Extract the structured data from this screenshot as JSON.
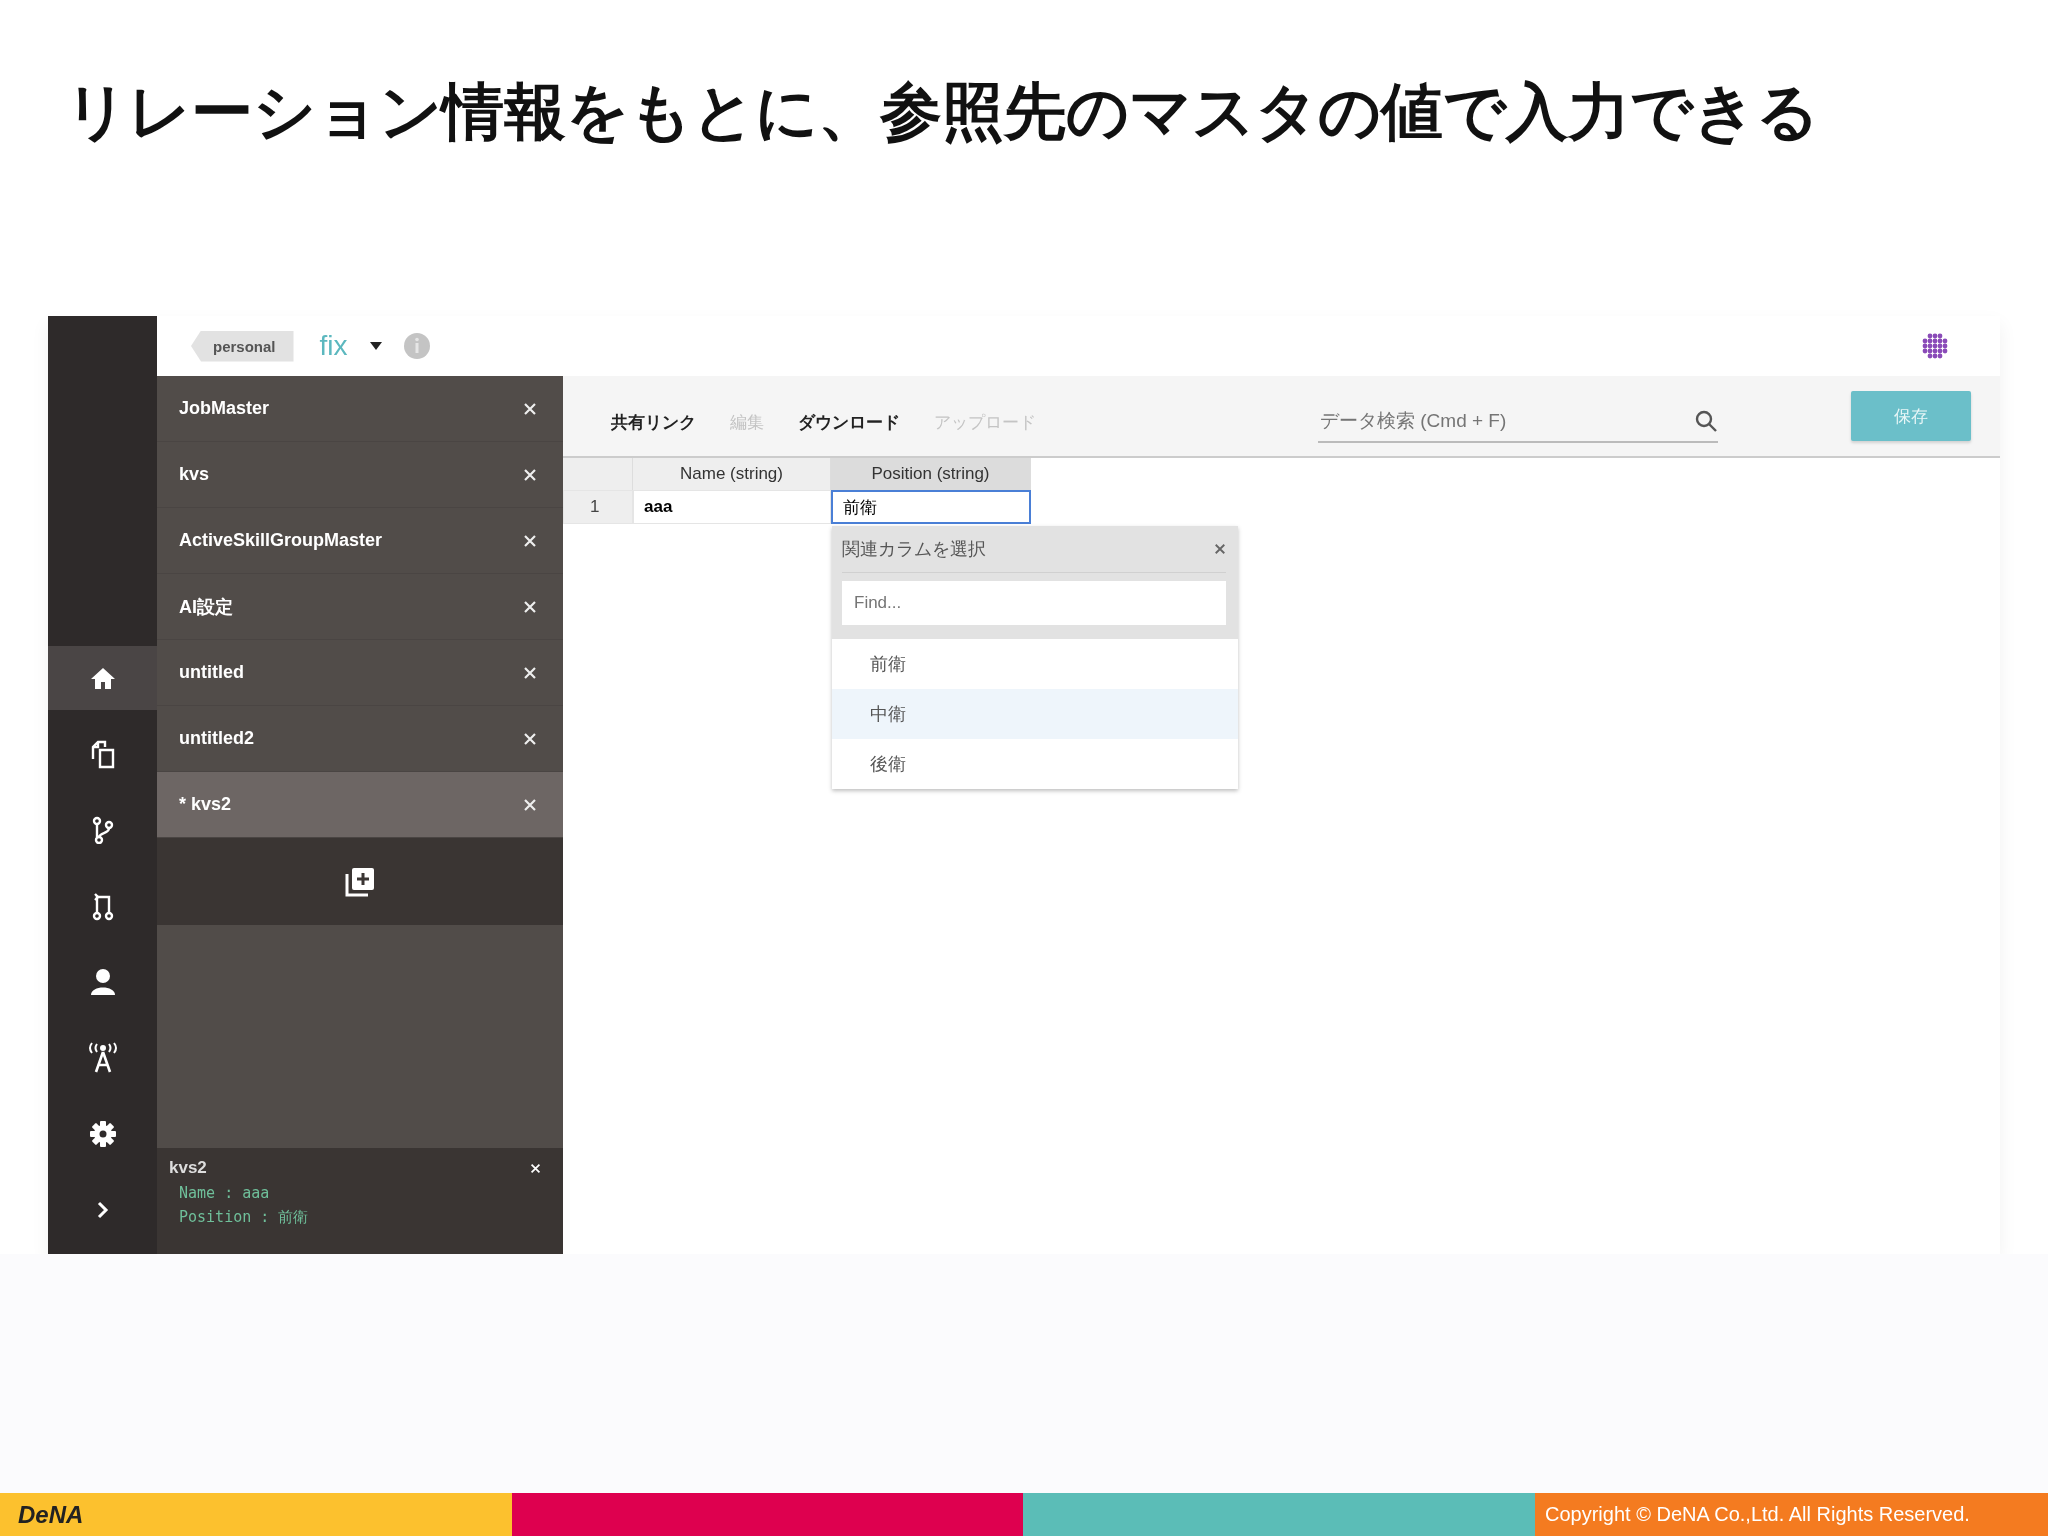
{
  "slide_title": "リレーション情報をもとに、参照先のマスタの値で入力できる",
  "app": {
    "top_bar": {
      "tag": "personal",
      "project": "fix"
    },
    "rail": [
      {
        "kind": "home",
        "selected": true
      },
      {
        "kind": "copy",
        "selected": false
      },
      {
        "kind": "branch",
        "selected": false
      },
      {
        "kind": "merge",
        "selected": false
      },
      {
        "kind": "user",
        "selected": false
      },
      {
        "kind": "antenna",
        "selected": false
      },
      {
        "kind": "settings",
        "selected": false
      },
      {
        "kind": "expand",
        "selected": false
      }
    ],
    "sidebar": {
      "tabs": [
        {
          "label": "JobMaster",
          "selected": false
        },
        {
          "label": "kvs",
          "selected": false
        },
        {
          "label": "ActiveSkillGroupMaster",
          "selected": false
        },
        {
          "label": "AI設定",
          "selected": false
        },
        {
          "label": "untitled",
          "selected": false
        },
        {
          "label": "untitled2",
          "selected": false
        },
        {
          "label": "* kvs2",
          "selected": true
        }
      ],
      "detail": {
        "title": "kvs2",
        "lines": [
          "Name : aaa",
          "Position : 前衛"
        ]
      }
    },
    "toolbar": {
      "actions": [
        {
          "label": "共有リンク",
          "disabled": false
        },
        {
          "label": "編集",
          "disabled": true
        },
        {
          "label": "ダウンロード",
          "disabled": false
        },
        {
          "label": "アップロード",
          "disabled": true
        }
      ],
      "search": {
        "placeholder": "データ検索 (Cmd + F)"
      },
      "save_button": "保存"
    },
    "table": {
      "columns": [
        {
          "label": "Name (string)",
          "selected": false
        },
        {
          "label": "Position (string)",
          "selected": true
        }
      ],
      "rows": [
        {
          "number": "1",
          "cells": [
            {
              "text": "aaa",
              "editing": false
            },
            {
              "text": "前衛",
              "editing": true
            }
          ]
        }
      ]
    },
    "relation_picker": {
      "title": "関連カラムを選択",
      "search": {
        "placeholder": "Find..."
      },
      "options": [
        {
          "label": "前衛",
          "selected": false
        },
        {
          "label": "中衛",
          "selected": true
        },
        {
          "label": "後衛",
          "selected": false
        }
      ]
    }
  },
  "footer": {
    "logo": "DeNA",
    "copyright": "Copyright © DeNA Co.,Ltd. All Rights Reserved."
  }
}
